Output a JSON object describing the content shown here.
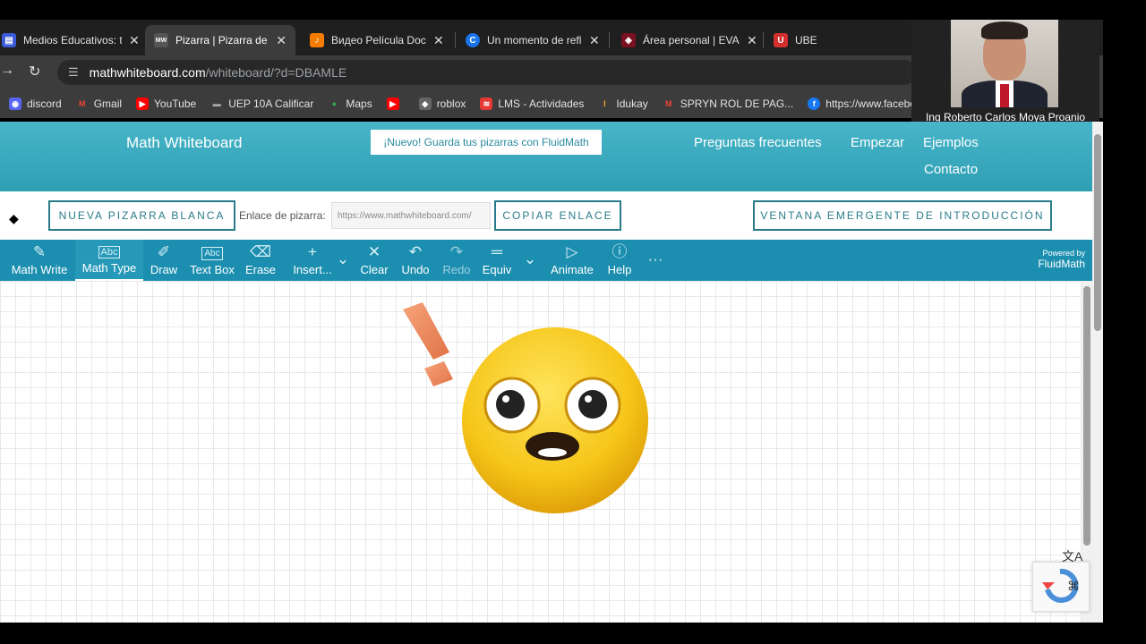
{
  "browser": {
    "tabs": [
      {
        "label": "Medios Educativos: tu",
        "color": "#3b5bdb"
      },
      {
        "label": "Pizarra | Pizarra de m",
        "color": "#444"
      },
      {
        "label": "Видео Película Doce",
        "color": "#f57c00"
      },
      {
        "label": "Un momento de refle",
        "color": "#1a73e8"
      },
      {
        "label": "Área personal | EVA-U",
        "color": "#7a1020"
      },
      {
        "label": "UBE",
        "color": "#d32f2f"
      }
    ],
    "url_host": "mathwhiteboard.com",
    "url_path": "/whiteboard/?d=DBAMLE",
    "bookmarks": [
      {
        "label": "discord",
        "color": "#5865f2"
      },
      {
        "label": "Gmail",
        "color": "#ea4335"
      },
      {
        "label": "YouTube",
        "color": "#ff0000"
      },
      {
        "label": "UEP 10A Calificar",
        "color": "#444"
      },
      {
        "label": "Maps",
        "color": "#34a853"
      },
      {
        "label": "",
        "color": "#ff0000"
      },
      {
        "label": "roblox",
        "color": "#666"
      },
      {
        "label": "LMS - Actividades",
        "color": "#e53935"
      },
      {
        "label": "Idukay",
        "color": "#f9a825"
      },
      {
        "label": "SPRYN ROL DE PAG...",
        "color": "#ea4335"
      },
      {
        "label": "https://www.facebo...",
        "color": "#1877f2"
      }
    ]
  },
  "webcam": {
    "name": "Ing Roberto Carlos Moya Proanio"
  },
  "site": {
    "brand": "Math Whiteboard",
    "promo": "¡Nuevo! Guarda tus pizarras con FluidMath",
    "nav": [
      "Preguntas frecuentes",
      "Empezar",
      "Ejemplos",
      "Contacto"
    ],
    "new_board": "NUEVA PIZARRA BLANCA",
    "link_label": "Enlace de pizarra:",
    "link_value": "https://www.mathwhiteboard.com/",
    "copy_link": "COPIAR ENLACE",
    "intro_popup": "VENTANA EMERGENTE DE INTRODUCCIÓN"
  },
  "toolbar": {
    "tools": [
      "Math Write",
      "Math Type",
      "Draw",
      "Text Box",
      "Erase",
      "Insert...",
      "Clear",
      "Undo",
      "Redo",
      "Equiv",
      "Animate",
      "Help"
    ],
    "powered_1": "Powered by",
    "powered_2": "FluidMath"
  },
  "colors": {
    "header": "#2f9fb4",
    "toolbar": "#1c8fb0",
    "emoji": "#f5c518"
  }
}
